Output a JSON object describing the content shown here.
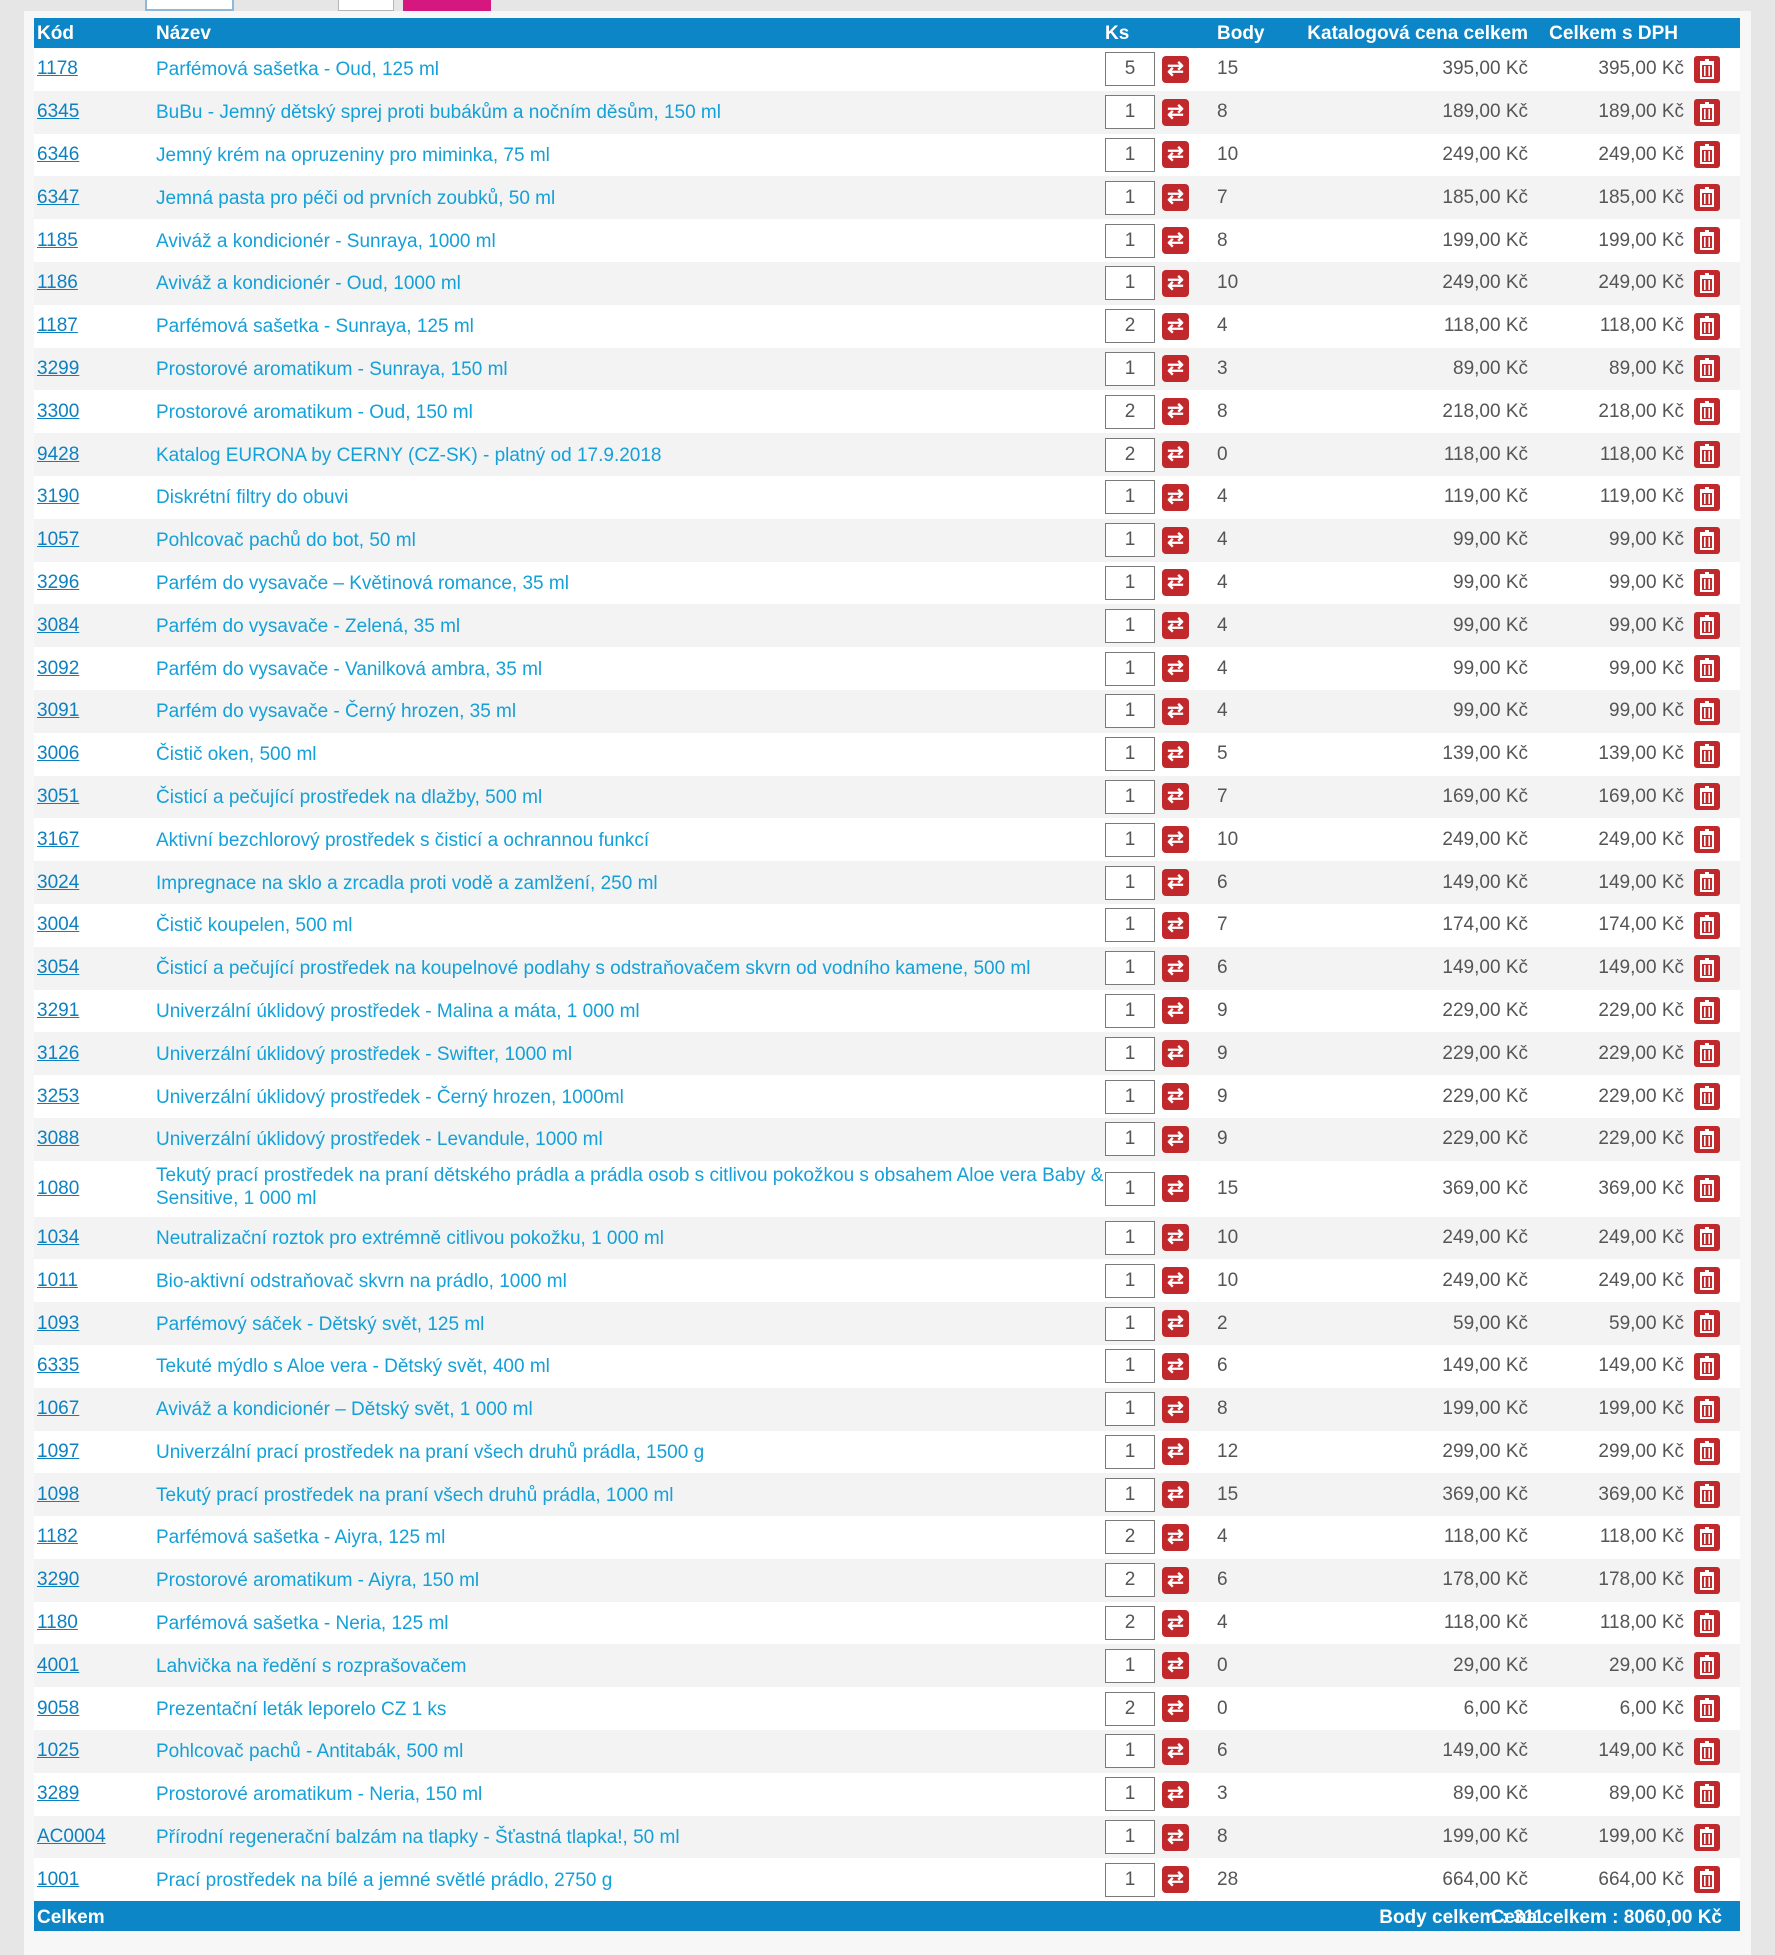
{
  "header": {
    "code": "Kód",
    "name": "Název",
    "qty": "Ks",
    "points": "Body",
    "catalog": "Katalogová cena celkem",
    "total_vat": "Celkem s DPH"
  },
  "rows": [
    {
      "code": "1178",
      "name": "Parfémová sašetka - Oud, 125 ml",
      "qty": "5",
      "points": "15",
      "catalog": "395,00 Kč",
      "total": "395,00 Kč"
    },
    {
      "code": "6345",
      "name": "BuBu - Jemný dětský sprej proti bubákům a nočním děsům, 150 ml",
      "qty": "1",
      "points": "8",
      "catalog": "189,00 Kč",
      "total": "189,00 Kč"
    },
    {
      "code": "6346",
      "name": "Jemný krém na opruzeniny pro miminka, 75 ml",
      "qty": "1",
      "points": "10",
      "catalog": "249,00 Kč",
      "total": "249,00 Kč"
    },
    {
      "code": "6347",
      "name": "Jemná pasta pro péči od prvních zoubků, 50 ml",
      "qty": "1",
      "points": "7",
      "catalog": "185,00 Kč",
      "total": "185,00 Kč"
    },
    {
      "code": "1185",
      "name": "Aviváž a kondicionér - Sunraya, 1000 ml",
      "qty": "1",
      "points": "8",
      "catalog": "199,00 Kč",
      "total": "199,00 Kč"
    },
    {
      "code": "1186",
      "name": "Aviváž a kondicionér - Oud, 1000 ml",
      "qty": "1",
      "points": "10",
      "catalog": "249,00 Kč",
      "total": "249,00 Kč"
    },
    {
      "code": "1187",
      "name": "Parfémová sašetka - Sunraya, 125 ml",
      "qty": "2",
      "points": "4",
      "catalog": "118,00 Kč",
      "total": "118,00 Kč"
    },
    {
      "code": "3299",
      "name": "Prostorové aromatikum - Sunraya, 150 ml",
      "qty": "1",
      "points": "3",
      "catalog": "89,00 Kč",
      "total": "89,00 Kč"
    },
    {
      "code": "3300",
      "name": "Prostorové aromatikum - Oud, 150 ml",
      "qty": "2",
      "points": "8",
      "catalog": "218,00 Kč",
      "total": "218,00 Kč"
    },
    {
      "code": "9428",
      "name": "Katalog EURONA by CERNY (CZ-SK) - platný od 17.9.2018",
      "qty": "2",
      "points": "0",
      "catalog": "118,00 Kč",
      "total": "118,00 Kč"
    },
    {
      "code": "3190",
      "name": "Diskrétní filtry do obuvi",
      "qty": "1",
      "points": "4",
      "catalog": "119,00 Kč",
      "total": "119,00 Kč"
    },
    {
      "code": "1057",
      "name": "Pohlcovač pachů do bot, 50 ml",
      "qty": "1",
      "points": "4",
      "catalog": "99,00 Kč",
      "total": "99,00 Kč"
    },
    {
      "code": "3296",
      "name": "Parfém do vysavače – Květinová romance, 35 ml",
      "qty": "1",
      "points": "4",
      "catalog": "99,00 Kč",
      "total": "99,00 Kč"
    },
    {
      "code": "3084",
      "name": "Parfém do vysavače - Zelená, 35 ml",
      "qty": "1",
      "points": "4",
      "catalog": "99,00 Kč",
      "total": "99,00 Kč"
    },
    {
      "code": "3092",
      "name": "Parfém do vysavače - Vanilková ambra, 35 ml",
      "qty": "1",
      "points": "4",
      "catalog": "99,00 Kč",
      "total": "99,00 Kč"
    },
    {
      "code": "3091",
      "name": "Parfém do vysavače - Černý hrozen, 35 ml",
      "qty": "1",
      "points": "4",
      "catalog": "99,00 Kč",
      "total": "99,00 Kč"
    },
    {
      "code": "3006",
      "name": "Čistič oken, 500 ml",
      "qty": "1",
      "points": "5",
      "catalog": "139,00 Kč",
      "total": "139,00 Kč"
    },
    {
      "code": "3051",
      "name": "Čisticí a pečující prostředek na dlažby, 500 ml",
      "qty": "1",
      "points": "7",
      "catalog": "169,00 Kč",
      "total": "169,00 Kč"
    },
    {
      "code": "3167",
      "name": "Aktivní bezchlorový prostředek s čisticí a ochrannou funkcí",
      "qty": "1",
      "points": "10",
      "catalog": "249,00 Kč",
      "total": "249,00 Kč"
    },
    {
      "code": "3024",
      "name": "Impregnace na sklo a zrcadla proti vodě a zamlžení, 250 ml",
      "qty": "1",
      "points": "6",
      "catalog": "149,00 Kč",
      "total": "149,00 Kč"
    },
    {
      "code": "3004",
      "name": "Čistič koupelen, 500 ml",
      "qty": "1",
      "points": "7",
      "catalog": "174,00 Kč",
      "total": "174,00 Kč"
    },
    {
      "code": "3054",
      "name": "Čisticí a pečující prostředek na koupelnové podlahy s odstraňovačem skvrn od vodního kamene, 500 ml",
      "qty": "1",
      "points": "6",
      "catalog": "149,00 Kč",
      "total": "149,00 Kč"
    },
    {
      "code": "3291",
      "name": "Univerzální úklidový prostředek - Malina a máta, 1 000 ml",
      "qty": "1",
      "points": "9",
      "catalog": "229,00 Kč",
      "total": "229,00 Kč"
    },
    {
      "code": "3126",
      "name": "Univerzální úklidový prostředek - Swifter, 1000 ml",
      "qty": "1",
      "points": "9",
      "catalog": "229,00 Kč",
      "total": "229,00 Kč"
    },
    {
      "code": "3253",
      "name": "Univerzální úklidový prostředek - Černý hrozen, 1000ml",
      "qty": "1",
      "points": "9",
      "catalog": "229,00 Kč",
      "total": "229,00 Kč"
    },
    {
      "code": "3088",
      "name": "Univerzální úklidový prostředek - Levandule, 1000 ml",
      "qty": "1",
      "points": "9",
      "catalog": "229,00 Kč",
      "total": "229,00 Kč"
    },
    {
      "code": "1080",
      "name": "Tekutý prací prostředek na praní dětského prádla a prádla osob s citlivou pokožkou s obsahem Aloe vera Baby & Sensitive, 1 000 ml",
      "qty": "1",
      "points": "15",
      "catalog": "369,00 Kč",
      "total": "369,00 Kč",
      "tall": true
    },
    {
      "code": "1034",
      "name": "Neutralizační roztok pro extrémně citlivou pokožku, 1 000 ml",
      "qty": "1",
      "points": "10",
      "catalog": "249,00 Kč",
      "total": "249,00 Kč"
    },
    {
      "code": "1011",
      "name": "Bio-aktivní odstraňovač skvrn na prádlo, 1000 ml",
      "qty": "1",
      "points": "10",
      "catalog": "249,00 Kč",
      "total": "249,00 Kč"
    },
    {
      "code": "1093",
      "name": "Parfémový sáček - Dětský svět, 125 ml",
      "qty": "1",
      "points": "2",
      "catalog": "59,00 Kč",
      "total": "59,00 Kč"
    },
    {
      "code": "6335",
      "name": "Tekuté mýdlo s Aloe vera - Dětský svět, 400 ml",
      "qty": "1",
      "points": "6",
      "catalog": "149,00 Kč",
      "total": "149,00 Kč"
    },
    {
      "code": "1067",
      "name": "Aviváž a kondicionér – Dětský svět, 1 000 ml",
      "qty": "1",
      "points": "8",
      "catalog": "199,00 Kč",
      "total": "199,00 Kč"
    },
    {
      "code": "1097",
      "name": "Univerzální prací prostředek na praní všech druhů prádla, 1500 g",
      "qty": "1",
      "points": "12",
      "catalog": "299,00 Kč",
      "total": "299,00 Kč"
    },
    {
      "code": "1098",
      "name": "Tekutý prací prostředek na praní všech druhů prádla, 1000 ml",
      "qty": "1",
      "points": "15",
      "catalog": "369,00 Kč",
      "total": "369,00 Kč"
    },
    {
      "code": "1182",
      "name": "Parfémová sašetka - Aiyra, 125 ml",
      "qty": "2",
      "points": "4",
      "catalog": "118,00 Kč",
      "total": "118,00 Kč"
    },
    {
      "code": "3290",
      "name": "Prostorové aromatikum - Aiyra, 150 ml",
      "qty": "2",
      "points": "6",
      "catalog": "178,00 Kč",
      "total": "178,00 Kč"
    },
    {
      "code": "1180",
      "name": "Parfémová sašetka - Neria, 125 ml",
      "qty": "2",
      "points": "4",
      "catalog": "118,00 Kč",
      "total": "118,00 Kč"
    },
    {
      "code": "4001",
      "name": "Lahvička na ředění s rozprašovačem",
      "qty": "1",
      "points": "0",
      "catalog": "29,00 Kč",
      "total": "29,00 Kč"
    },
    {
      "code": "9058",
      "name": "Prezentační leták leporelo CZ 1 ks",
      "qty": "2",
      "points": "0",
      "catalog": "6,00 Kč",
      "total": "6,00 Kč"
    },
    {
      "code": "1025",
      "name": "Pohlcovač pachů - Antitabák, 500 ml",
      "qty": "1",
      "points": "6",
      "catalog": "149,00 Kč",
      "total": "149,00 Kč"
    },
    {
      "code": "3289",
      "name": "Prostorové aromatikum - Neria, 150 ml",
      "qty": "1",
      "points": "3",
      "catalog": "89,00 Kč",
      "total": "89,00 Kč"
    },
    {
      "code": "AC0004",
      "name": "Přírodní regenerační balzám na tlapky - Šťastná tlapka!, 50 ml",
      "qty": "1",
      "points": "8",
      "catalog": "199,00 Kč",
      "total": "199,00 Kč"
    },
    {
      "code": "1001",
      "name": "Prací prostředek na bílé a jemné světlé prádlo, 2750 g",
      "qty": "1",
      "points": "28",
      "catalog": "664,00 Kč",
      "total": "664,00 Kč"
    }
  ],
  "footer": {
    "label": "Celkem",
    "points_total": "Body celkem : 311",
    "price_total": "Cena celkem : 8060,00 Kč"
  },
  "icons": {
    "refresh": "refresh-icon",
    "delete": "trash-icon"
  },
  "colors": {
    "header_bg": "#0c86c6",
    "link": "#14a0d8",
    "icon_red": "#c0282c",
    "accent_button": "#d4187f"
  }
}
